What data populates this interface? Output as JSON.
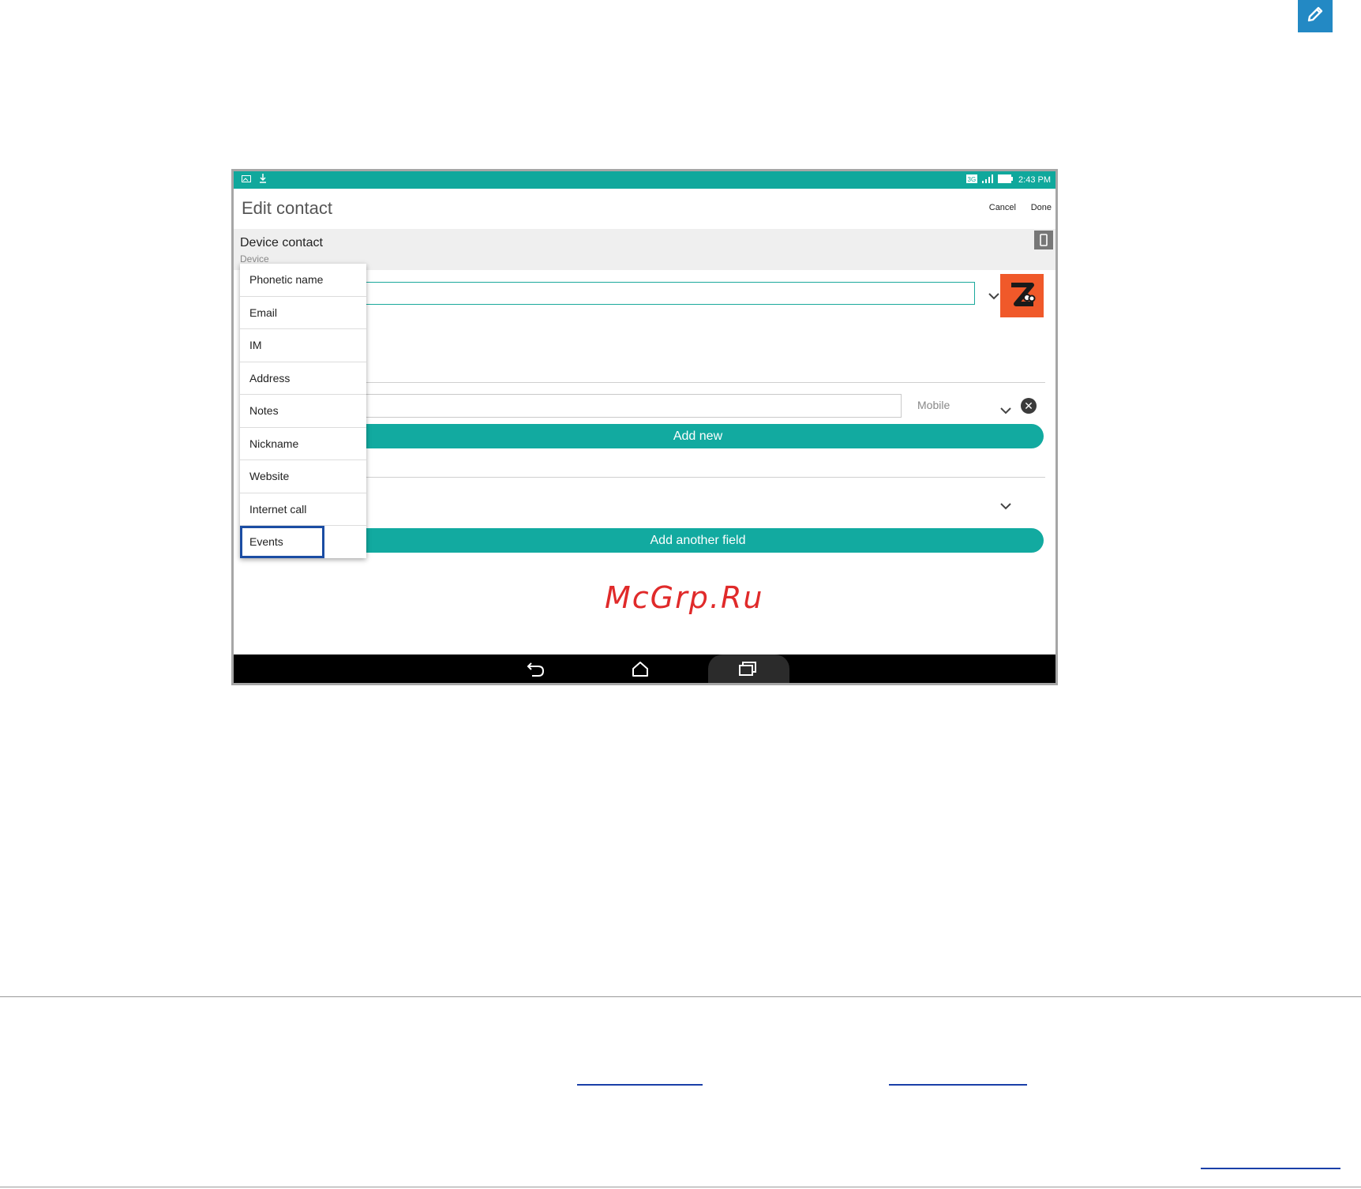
{
  "page": {
    "edit_badge_icon": "pencil-icon"
  },
  "status_bar": {
    "left_icons": [
      "image-notification-icon",
      "download-icon"
    ],
    "right_icons": [
      "3g-icon",
      "signal-icon",
      "battery-icon"
    ],
    "time": "2:43 PM"
  },
  "app_bar": {
    "title": "Edit contact",
    "cancel_label": "Cancel",
    "done_label": "Done"
  },
  "account": {
    "name": "Device contact",
    "type": "Device",
    "icon": "device-icon"
  },
  "phone": {
    "type_label": "Mobile"
  },
  "buttons": {
    "add_new": "Add new",
    "add_another_field": "Add another field"
  },
  "popup_menu": {
    "items": [
      "Phonetic name",
      "Email",
      "IM",
      "Address",
      "Notes",
      "Nickname",
      "Website",
      "Internet call",
      "Events"
    ],
    "highlighted": "Events"
  },
  "watermark": "McGrp.Ru",
  "nav_bar": {
    "icons": [
      "back-icon",
      "home-icon",
      "recents-icon"
    ]
  },
  "colors": {
    "teal": "#12aaa0",
    "badge_blue": "#2389c4",
    "highlight_blue": "#1b4da3",
    "avatar_orange": "#f0592a",
    "watermark_red": "#e02a2a"
  }
}
